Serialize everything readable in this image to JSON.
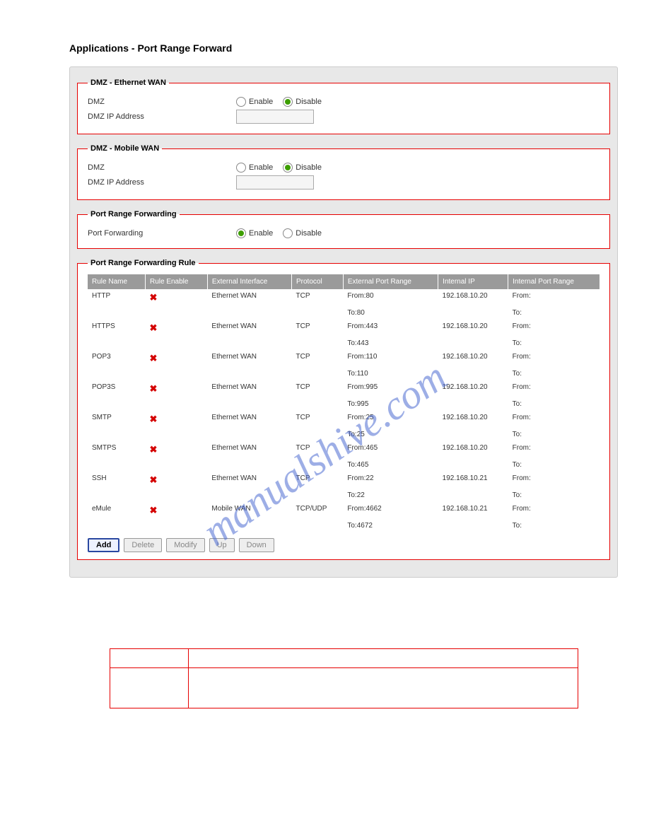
{
  "title": "Applications - Port Range Forward",
  "watermark": "manualshive.com",
  "dmz_eth": {
    "legend": "DMZ - Ethernet WAN",
    "enable_label": "Enable",
    "disable_label": "Disable",
    "dmz_label": "DMZ",
    "ip_label": "DMZ IP Address",
    "selected": "disable",
    "ip_value": ""
  },
  "dmz_mob": {
    "legend": "DMZ - Mobile WAN",
    "enable_label": "Enable",
    "disable_label": "Disable",
    "dmz_label": "DMZ",
    "ip_label": "DMZ IP Address",
    "selected": "disable",
    "ip_value": ""
  },
  "pfw": {
    "legend": "Port Range Forwarding",
    "label": "Port Forwarding",
    "enable_label": "Enable",
    "disable_label": "Disable",
    "selected": "enable"
  },
  "rules": {
    "legend": "Port Range Forwarding Rule",
    "headers": {
      "name": "Rule Name",
      "enable": "Rule Enable",
      "iface": "External Interface",
      "proto": "Protocol",
      "ext_range": "External Port Range",
      "int_ip": "Internal IP",
      "int_range": "Internal Port Range"
    },
    "from_label": "From:",
    "to_label": "To:",
    "items": [
      {
        "name": "HTTP",
        "enabled": false,
        "iface": "Ethernet WAN",
        "proto": "TCP",
        "ext_from": "80",
        "ext_to": "80",
        "ip": "192.168.10.20",
        "int_from": "",
        "int_to": ""
      },
      {
        "name": "HTTPS",
        "enabled": false,
        "iface": "Ethernet WAN",
        "proto": "TCP",
        "ext_from": "443",
        "ext_to": "443",
        "ip": "192.168.10.20",
        "int_from": "",
        "int_to": ""
      },
      {
        "name": "POP3",
        "enabled": false,
        "iface": "Ethernet WAN",
        "proto": "TCP",
        "ext_from": "110",
        "ext_to": "110",
        "ip": "192.168.10.20",
        "int_from": "",
        "int_to": ""
      },
      {
        "name": "POP3S",
        "enabled": false,
        "iface": "Ethernet WAN",
        "proto": "TCP",
        "ext_from": "995",
        "ext_to": "995",
        "ip": "192.168.10.20",
        "int_from": "",
        "int_to": ""
      },
      {
        "name": "SMTP",
        "enabled": false,
        "iface": "Ethernet WAN",
        "proto": "TCP",
        "ext_from": "25",
        "ext_to": "25",
        "ip": "192.168.10.20",
        "int_from": "",
        "int_to": ""
      },
      {
        "name": "SMTPS",
        "enabled": false,
        "iface": "Ethernet WAN",
        "proto": "TCP",
        "ext_from": "465",
        "ext_to": "465",
        "ip": "192.168.10.20",
        "int_from": "",
        "int_to": ""
      },
      {
        "name": "SSH",
        "enabled": false,
        "iface": "Ethernet WAN",
        "proto": "TCP",
        "ext_from": "22",
        "ext_to": "22",
        "ip": "192.168.10.21",
        "int_from": "",
        "int_to": ""
      },
      {
        "name": "eMule",
        "enabled": false,
        "iface": "Mobile WAN",
        "proto": "TCP/UDP",
        "ext_from": "4662",
        "ext_to": "4672",
        "ip": "192.168.10.21",
        "int_from": "",
        "int_to": ""
      }
    ],
    "buttons": {
      "add": "Add",
      "delete": "Delete",
      "modify": "Modify",
      "up": "Up",
      "down": "Down"
    }
  }
}
